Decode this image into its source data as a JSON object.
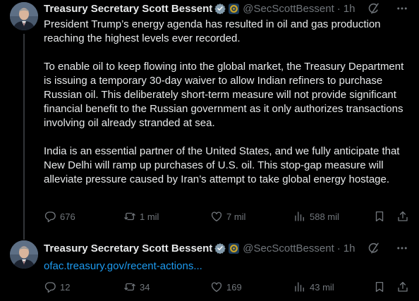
{
  "posts": [
    {
      "display_name": "Treasury Secretary Scott Bessent",
      "handle": "@SecScottBessent",
      "separator": "·",
      "time": "1h",
      "paragraphs": [
        "President Trump’s energy agenda has resulted in oil and gas production reaching the highest levels ever recorded.",
        "To enable oil to keep flowing into the global market, the Treasury Department is issuing a temporary 30-day waiver to allow Indian refiners to purchase Russian oil. This deliberately short-term measure will not provide significant financial benefit to the Russian government as it only authorizes transactions involving oil already stranded at sea.",
        "India is an essential partner of the United States, and we fully anticipate that New Delhi will ramp up purchases of U.S. oil. This stop-gap measure will alleviate pressure caused by Iran’s attempt to take global energy hostage."
      ],
      "stats": {
        "replies": "676",
        "reposts": "1 mil",
        "likes": "7 mil",
        "views": "588 mil"
      }
    },
    {
      "display_name": "Treasury Secretary Scott Bessent",
      "handle": "@SecScottBessent",
      "separator": "·",
      "time": "1h",
      "link_text": "ofac.treasury.gov/recent-actions...",
      "stats": {
        "replies": "12",
        "reposts": "34",
        "likes": "169",
        "views": "43 mil"
      }
    }
  ],
  "icons": [
    "verified-badge-icon",
    "government-badge-icon",
    "grok-icon",
    "more-icon",
    "reply-icon",
    "repost-icon",
    "like-icon",
    "views-icon",
    "bookmark-icon",
    "share-icon"
  ],
  "colors": {
    "background": "#000000",
    "text": "#e7e9ea",
    "secondary": "#71767b",
    "link": "#1d9bf0",
    "divider": "#333639",
    "verified_badge": "#829aab"
  }
}
